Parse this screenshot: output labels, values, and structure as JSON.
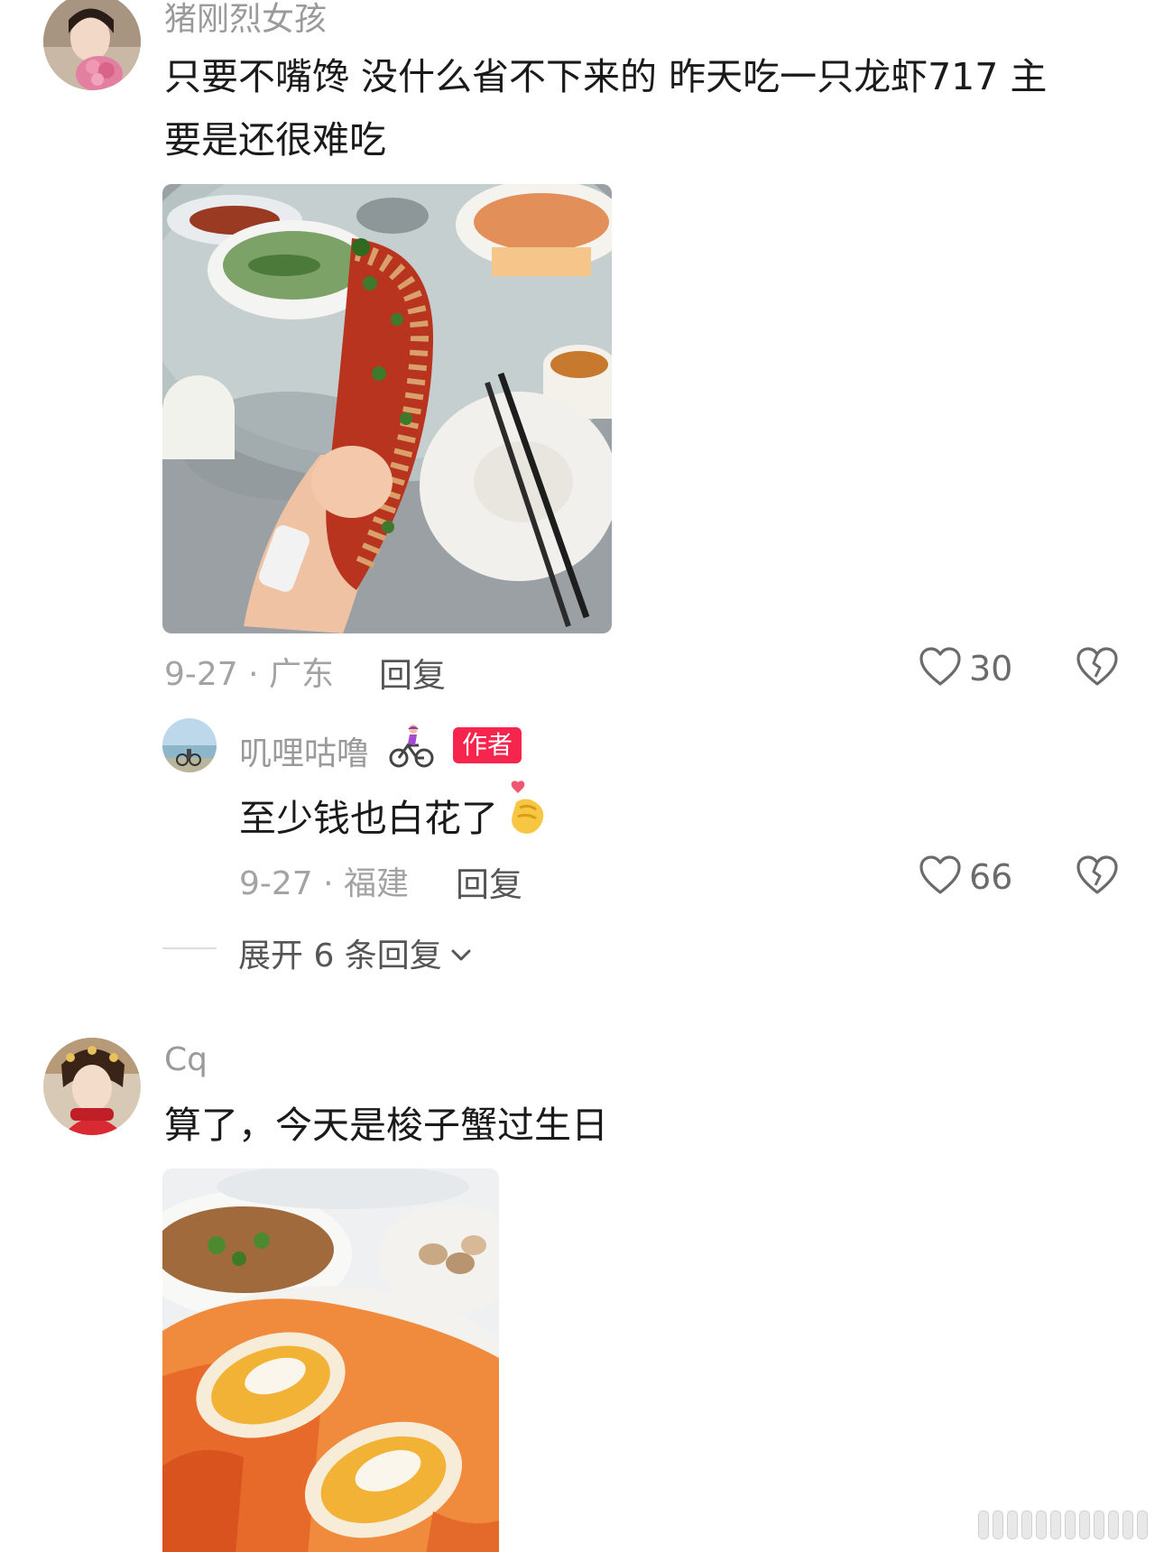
{
  "comments": [
    {
      "username": "猪刚烈女孩",
      "text_line1": "只要不嘴馋 没什么省不下来的 昨天吃一只龙虾717 主",
      "text_line2": "要是还很难吃",
      "meta": "9-27 · 广东",
      "reply_label": "回复",
      "likes": "30",
      "reply": {
        "username": "叽哩咕噜",
        "badge": "作者",
        "text": "至少钱也白花了",
        "meta": "9-27 · 福建",
        "reply_label": "回复",
        "likes": "66"
      },
      "expand_label": "展开 6 条回复"
    },
    {
      "username": "Cq",
      "text": "算了，今天是梭子蟹过生日"
    }
  ],
  "icons": {
    "like": "heart-outline-icon",
    "dislike": "broken-heart-icon",
    "expand": "chevron-down-icon",
    "cyclist_emoji": "cyclist-emoji-icon",
    "finger_heart_emoji": "finger-heart-emoji-icon"
  },
  "colors": {
    "author_badge": "#f5254e",
    "meta_text": "#a3a3a3",
    "username_text": "#9a9a9a",
    "body_text": "#1a1a1a"
  }
}
